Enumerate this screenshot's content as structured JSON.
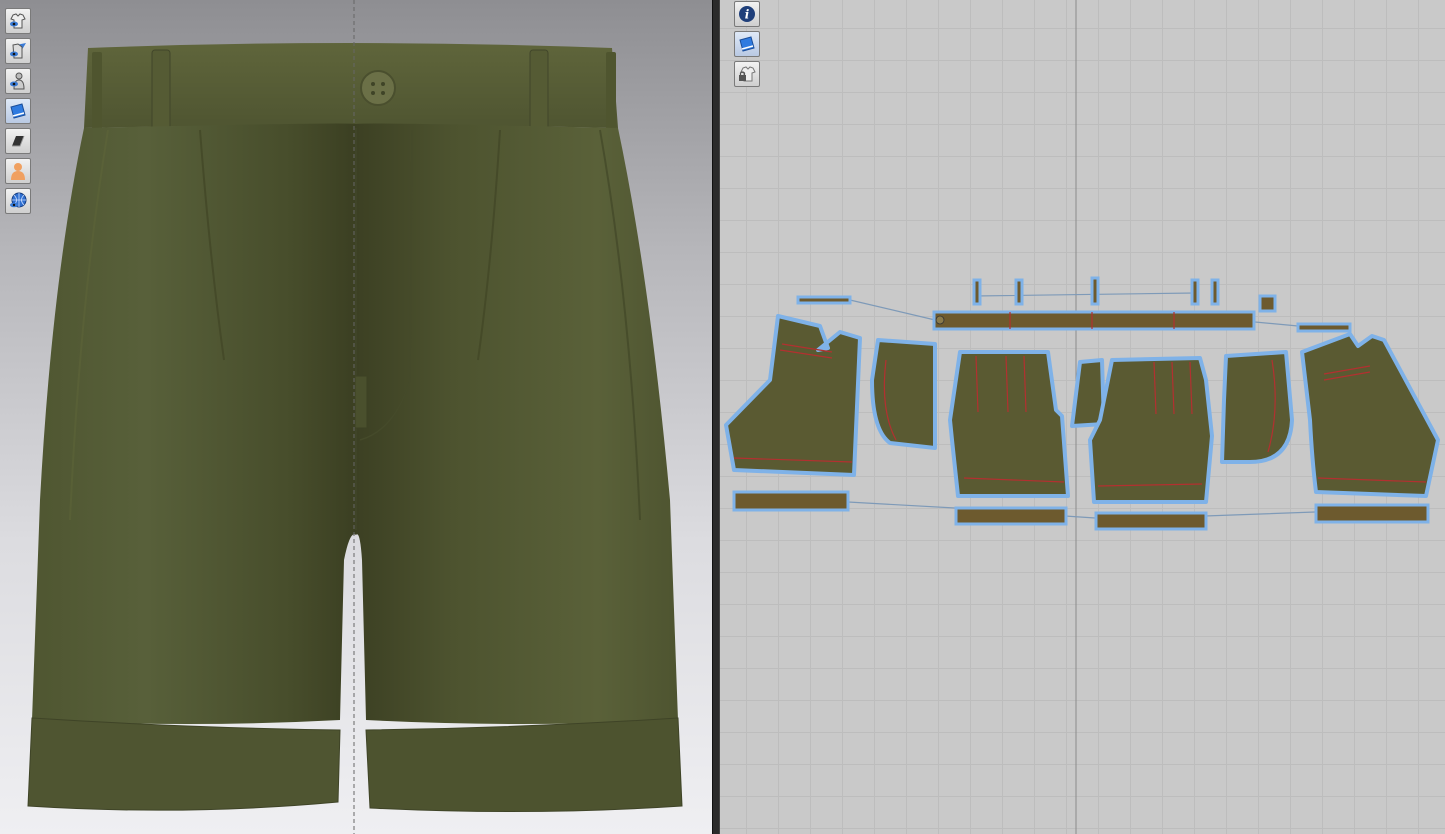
{
  "app": {
    "view_3d": {
      "toolbar": [
        {
          "name": "show-garment-icon"
        },
        {
          "name": "show-texture-icon"
        },
        {
          "name": "show-avatar-icon"
        },
        {
          "name": "fabric-render-icon"
        },
        {
          "name": "display-mode-icon"
        },
        {
          "name": "avatar-skin-icon"
        },
        {
          "name": "environment-globe-icon"
        }
      ],
      "garment": {
        "type": "pleated-shorts",
        "color": "#4e5330"
      }
    },
    "view_2d": {
      "toolbar": [
        {
          "name": "info-icon"
        },
        {
          "name": "texture-view-icon"
        },
        {
          "name": "lock-garment-icon"
        }
      ],
      "pattern_piece_color": "#5a5a32",
      "outline_color": "#7fb2e8",
      "internal_line_color": "#b33030"
    }
  }
}
